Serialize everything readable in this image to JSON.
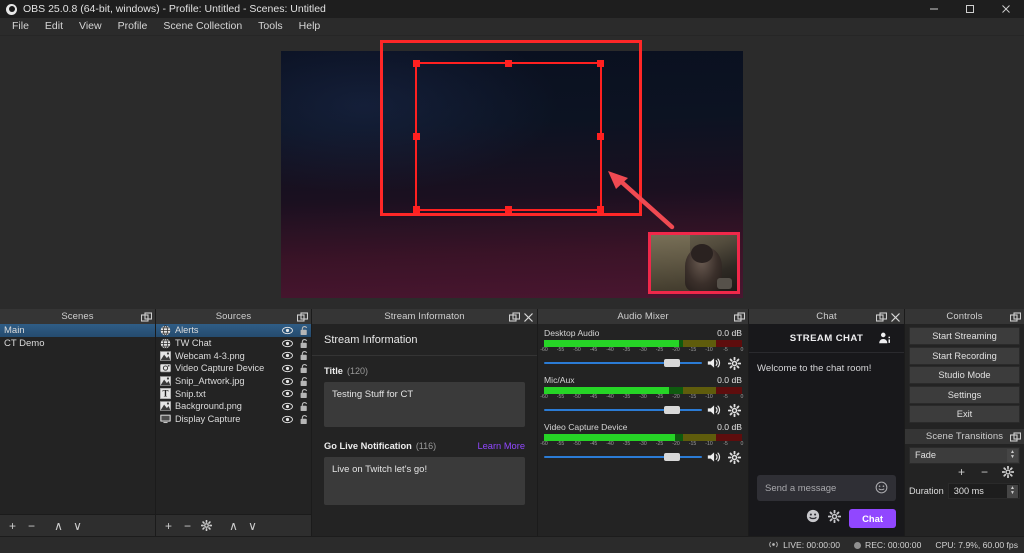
{
  "titlebar": {
    "title": "OBS 25.0.8 (64-bit, windows) - Profile: Untitled - Scenes: Untitled",
    "minimize": "minimize-icon",
    "maximize": "maximize-icon",
    "close": "close-icon"
  },
  "menu": {
    "items": [
      "File",
      "Edit",
      "View",
      "Profile",
      "Scene Collection",
      "Tools",
      "Help"
    ]
  },
  "preview": {
    "annotation_arrow": "red-arrow-annotation",
    "annotation_rect": "red-rectangle-annotation",
    "selection": "source-selection-box",
    "webcam": "webcam-pip"
  },
  "scenes": {
    "dock_title": "Scenes",
    "items": [
      {
        "label": "Main",
        "selected": true
      },
      {
        "label": "CT Demo",
        "selected": false
      }
    ],
    "toolbar": [
      {
        "name": "add-scene-button",
        "glyph": "+"
      },
      {
        "name": "remove-scene-button",
        "glyph": "−"
      },
      {
        "name": "move-scene-up-button",
        "glyph": "∧"
      },
      {
        "name": "move-scene-down-button",
        "glyph": "∨"
      }
    ]
  },
  "sources": {
    "dock_title": "Sources",
    "items": [
      {
        "label": "Alerts",
        "icon": "browser-icon",
        "selected": true,
        "visible": true,
        "locked": false
      },
      {
        "label": "TW Chat",
        "icon": "browser-icon",
        "selected": false,
        "visible": true,
        "locked": false
      },
      {
        "label": "Webcam 4-3.png",
        "icon": "image-icon",
        "selected": false,
        "visible": true,
        "locked": false
      },
      {
        "label": "Video Capture Device",
        "icon": "camera-icon",
        "selected": false,
        "visible": true,
        "locked": false
      },
      {
        "label": "Snip_Artwork.jpg",
        "icon": "image-icon",
        "selected": false,
        "visible": true,
        "locked": false
      },
      {
        "label": "Snip.txt",
        "icon": "text-icon",
        "selected": false,
        "visible": true,
        "locked": false
      },
      {
        "label": "Background.png",
        "icon": "image-icon",
        "selected": false,
        "visible": true,
        "locked": false
      },
      {
        "label": "Display Capture",
        "icon": "monitor-icon",
        "selected": false,
        "visible": true,
        "locked": false
      }
    ],
    "toolbar": [
      {
        "name": "add-source-button",
        "glyph": "+"
      },
      {
        "name": "remove-source-button",
        "glyph": "−"
      },
      {
        "name": "source-properties-button",
        "glyph": "gear"
      },
      {
        "name": "move-source-up-button",
        "glyph": "∧"
      },
      {
        "name": "move-source-down-button",
        "glyph": "∨"
      }
    ]
  },
  "stream_information": {
    "dock_title": "Stream Informaton",
    "heading": "Stream Information",
    "title_label": "Title",
    "title_count": "(120)",
    "title_value": "Testing Stuff for CT",
    "notification_label": "Go Live Notification",
    "notification_count": "(116)",
    "learn_more": "Learn More",
    "notification_value": "Live on Twitch let's go!"
  },
  "audio_mixer": {
    "dock_title": "Audio Mixer",
    "tick_labels": [
      "-60",
      "-55",
      "-50",
      "-45",
      "-40",
      "-35",
      "-30",
      "-25",
      "-20",
      "-15",
      "-10",
      "-5",
      "0"
    ],
    "channels": [
      {
        "name": "Desktop Audio",
        "db": "0.0 dB",
        "level_pct": 68,
        "volume_pct": 81,
        "muted": false
      },
      {
        "name": "Mic/Aux",
        "db": "0.0 dB",
        "level_pct": 63,
        "volume_pct": 81,
        "muted": false
      },
      {
        "name": "Video Capture Device",
        "db": "0.0 dB",
        "level_pct": 66,
        "volume_pct": 81,
        "muted": false
      }
    ]
  },
  "chat": {
    "dock_title": "Chat",
    "header": "STREAM CHAT",
    "welcome": "Welcome to the chat room!",
    "input_placeholder": "Send a message",
    "send_label": "Chat",
    "accent": "#9147ff"
  },
  "controls": {
    "dock_title": "Controls",
    "buttons": [
      "Start Streaming",
      "Start Recording",
      "Studio Mode",
      "Settings",
      "Exit"
    ]
  },
  "scene_transitions": {
    "dock_title": "Scene Transitions",
    "transition": "Fade",
    "duration_label": "Duration",
    "duration_value": "300 ms",
    "buttons": [
      {
        "name": "add-transition-button",
        "glyph": "+"
      },
      {
        "name": "remove-transition-button",
        "glyph": "−"
      },
      {
        "name": "transition-properties-button",
        "glyph": "gear"
      }
    ]
  },
  "statusbar": {
    "live": "LIVE: 00:00:00",
    "rec": "REC: 00:00:00",
    "cpu": "CPU: 7.9%, 60.00 fps"
  }
}
